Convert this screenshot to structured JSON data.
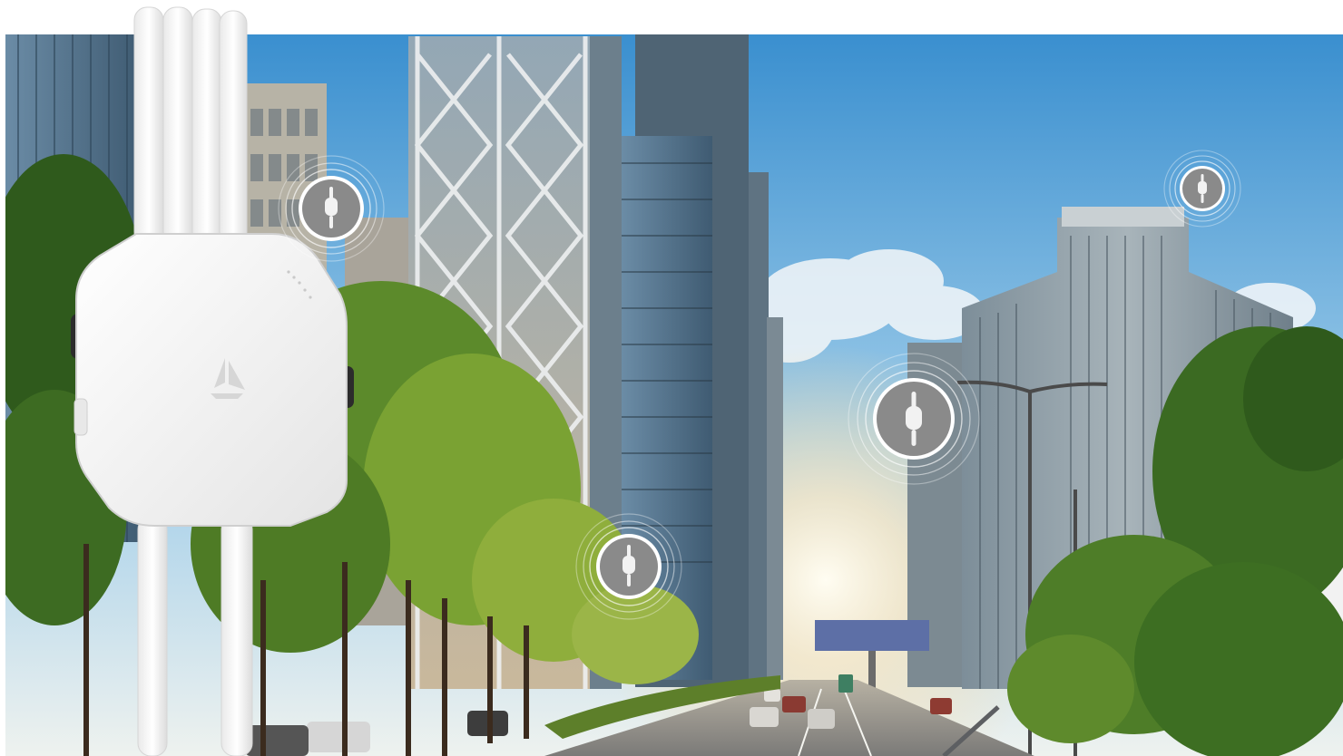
{
  "scene": {
    "colors": {
      "sky_top": "#3f95d1",
      "sky_bottom": "#cfe3ef",
      "haze": "#f6e6c4",
      "tree_dark": "#2f5a1c",
      "tree_light": "#6f9a2c",
      "building_glass": "#5f7f97",
      "road": "#8b8a86",
      "device_white": "#f4f4f4",
      "marker_gray": "#8a8a8a",
      "billboard": "#5d6fa6"
    },
    "device": {
      "icon": "outdoor-wifi-access-point",
      "logo_icon": "triangle-sail-logo"
    },
    "markers": [
      {
        "id": "marker-1",
        "icon": "access-point-pin"
      },
      {
        "id": "marker-2",
        "icon": "access-point-pin"
      },
      {
        "id": "marker-3",
        "icon": "access-point-pin"
      },
      {
        "id": "marker-4",
        "icon": "access-point-pin"
      }
    ]
  }
}
